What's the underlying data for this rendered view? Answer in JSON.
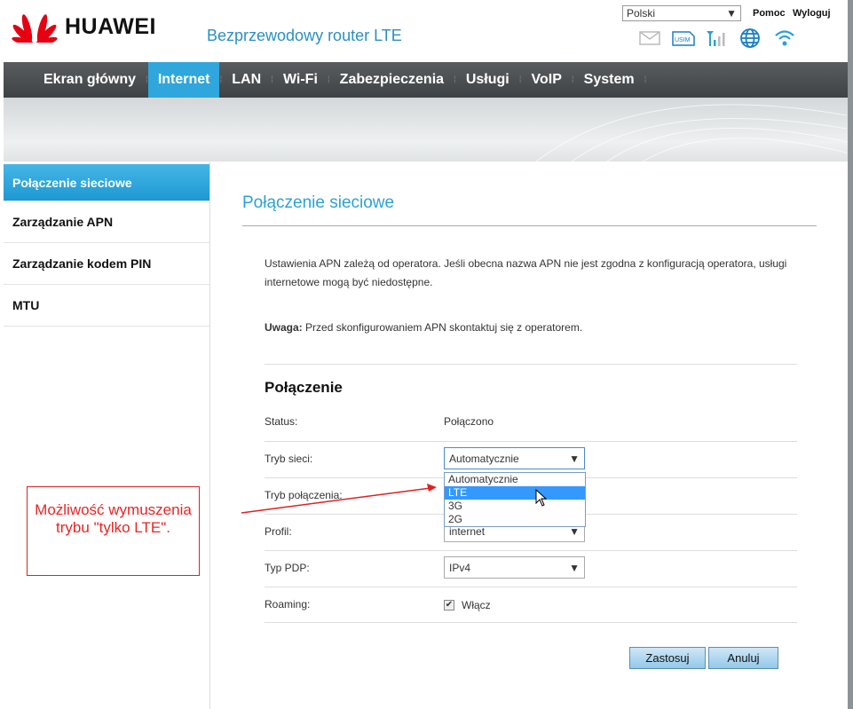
{
  "header": {
    "brand": "HUAWEI",
    "product": "Bezprzewodowy router LTE",
    "language": "Polski",
    "help": "Pomoc",
    "logout": "Wyloguj"
  },
  "nav": {
    "tabs": [
      "Ekran główny",
      "Internet",
      "LAN",
      "Wi-Fi",
      "Zabezpieczenia",
      "Usługi",
      "VoIP",
      "System"
    ],
    "active": "Internet"
  },
  "sidebar": {
    "items": [
      "Połączenie sieciowe",
      "Zarządzanie APN",
      "Zarządzanie kodem PIN",
      "MTU"
    ]
  },
  "main": {
    "title": "Połączenie sieciowe",
    "info": "Ustawienia APN zależą od operatora. Jeśli obecna nazwa APN nie jest zgodna z konfiguracją operatora, usługi internetowe mogą być niedostępne.",
    "note_label": "Uwaga:",
    "note_text": " Przed skonfigurowaniem APN skontaktuj się z operatorem.",
    "section": "Połączenie",
    "status_label": "Status:",
    "status_value": "Połączono",
    "network_mode_label": "Tryb sieci:",
    "network_mode_value": "Automatycznie",
    "network_mode_options": [
      "Automatycznie",
      "LTE",
      "3G",
      "2G"
    ],
    "highlighted_option": "LTE",
    "connection_mode_label": "Tryb połączenia:",
    "profile_label": "Profil:",
    "profile_value": "internet",
    "pdp_label": "Typ PDP:",
    "pdp_value": "IPv4",
    "roaming_label": "Roaming:",
    "roaming_checkbox": "Włącz",
    "roaming_checked": true,
    "apply": "Zastosuj",
    "cancel": "Anuluj"
  },
  "annotation": {
    "text": "Możliwość wymuszenia trybu \"tylko LTE\"."
  },
  "colors": {
    "accent": "#2fa6dc",
    "annotation": "#dd2222"
  }
}
